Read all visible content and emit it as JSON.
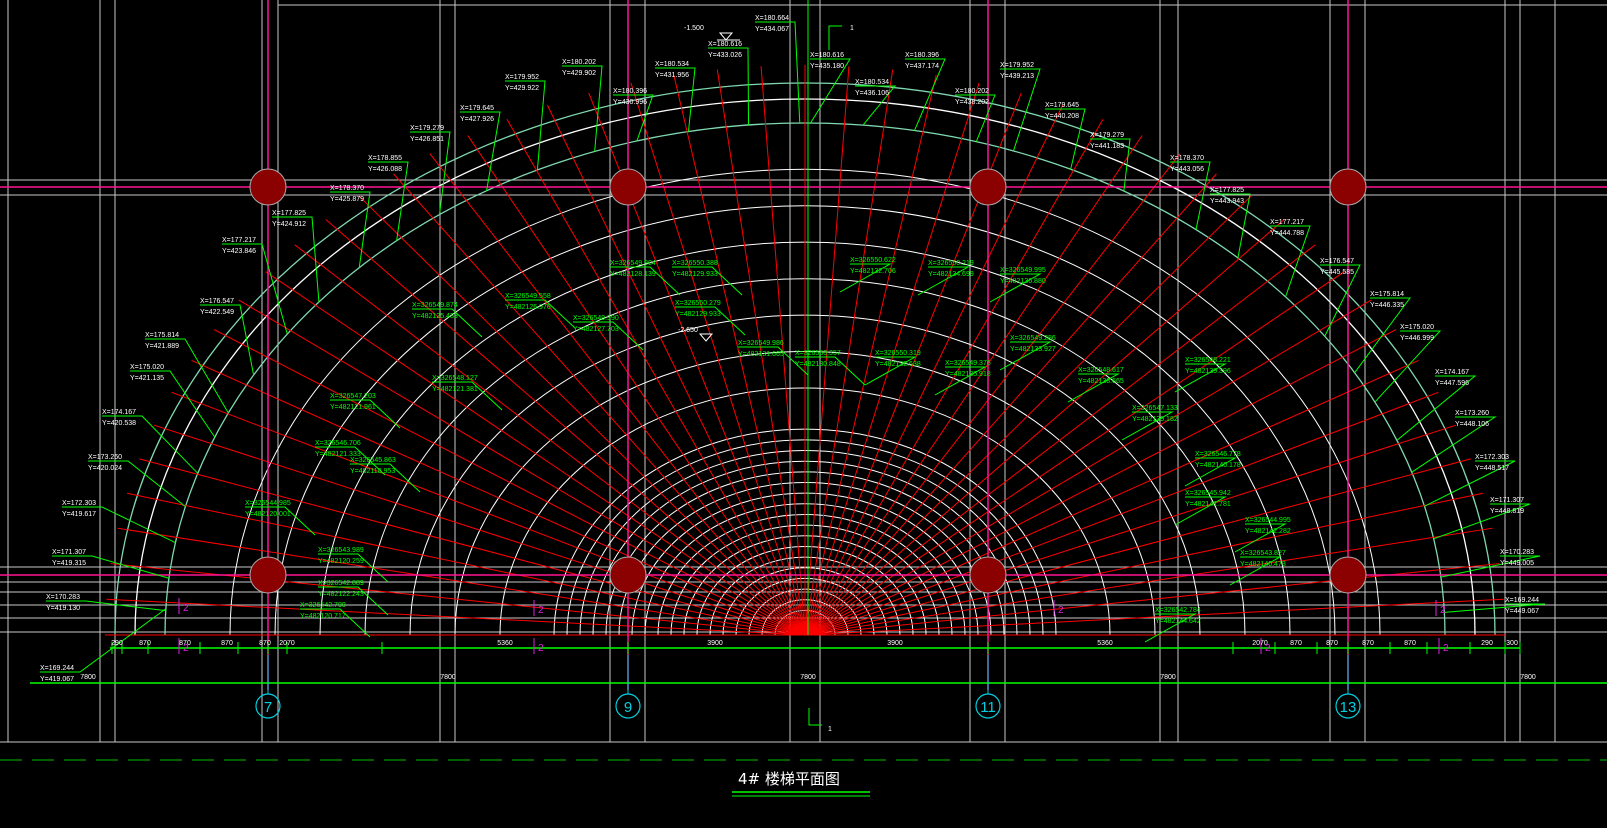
{
  "drawing": {
    "title": "4#  楼梯平面图",
    "section_mark": "1",
    "elevations": [
      "-1.500",
      "-2.650"
    ],
    "axis_labels": [
      "7",
      "9",
      "11",
      "13"
    ],
    "grid_mark": "2",
    "dimensions_row1": [
      "290",
      "870",
      "870",
      "870",
      "870",
      "2070",
      "5360",
      "3900",
      "3900",
      "5360",
      "2070",
      "870",
      "870",
      "870",
      "870",
      "290",
      "300"
    ],
    "dimensions_row2": [
      "7800",
      "7800",
      "7800",
      "7800",
      "7800"
    ],
    "outer_points": [
      {
        "x": "X=180.664",
        "y": "Y=434.067"
      },
      {
        "x": "X=180.616",
        "y": "Y=433.026"
      },
      {
        "x": "X=180.534",
        "y": "Y=431.956"
      },
      {
        "x": "X=180.396",
        "y": "Y=430.996"
      },
      {
        "x": "X=180.202",
        "y": "Y=429.902"
      },
      {
        "x": "X=179.952",
        "y": "Y=429.922"
      },
      {
        "x": "X=179.645",
        "y": "Y=427.926"
      },
      {
        "x": "X=179.279",
        "y": "Y=426.851"
      },
      {
        "x": "X=178.855",
        "y": "Y=426.088"
      },
      {
        "x": "X=178.370",
        "y": "Y=425.879"
      },
      {
        "x": "X=177.825",
        "y": "Y=424.912"
      },
      {
        "x": "X=177.217",
        "y": "Y=423.846"
      },
      {
        "x": "X=176.547",
        "y": "Y=422.549"
      },
      {
        "x": "X=175.814",
        "y": "Y=421.889"
      },
      {
        "x": "X=175.020",
        "y": "Y=421.135"
      },
      {
        "x": "X=174.167",
        "y": "Y=420.538"
      },
      {
        "x": "X=173.260",
        "y": "Y=420.024"
      },
      {
        "x": "X=172.303",
        "y": "Y=419.617"
      },
      {
        "x": "X=171.307",
        "y": "Y=419.315"
      },
      {
        "x": "X=170.283",
        "y": "Y=419.130"
      },
      {
        "x": "X=169.244",
        "y": "Y=419.067"
      },
      {
        "x": "X=180.616",
        "y": "Y=435.180"
      },
      {
        "x": "X=180.534",
        "y": "Y=436.106"
      },
      {
        "x": "X=180.396",
        "y": "Y=437.174"
      },
      {
        "x": "X=180.202",
        "y": "Y=438.202"
      },
      {
        "x": "X=179.952",
        "y": "Y=439.213"
      },
      {
        "x": "X=179.645",
        "y": "Y=440.208"
      },
      {
        "x": "X=179.279",
        "y": "Y=441.183"
      },
      {
        "x": "X=178.370",
        "y": "Y=443.056"
      },
      {
        "x": "X=177.825",
        "y": "Y=443.943"
      },
      {
        "x": "X=177.217",
        "y": "Y=444.788"
      },
      {
        "x": "X=176.547",
        "y": "Y=445.585"
      },
      {
        "x": "X=175.814",
        "y": "Y=446.335"
      },
      {
        "x": "X=175.020",
        "y": "Y=446.999"
      },
      {
        "x": "X=174.167",
        "y": "Y=447.596"
      },
      {
        "x": "X=173.260",
        "y": "Y=448.106"
      },
      {
        "x": "X=172.303",
        "y": "Y=448.517"
      },
      {
        "x": "X=171.307",
        "y": "Y=448.819"
      },
      {
        "x": "X=170.283",
        "y": "Y=449.005"
      },
      {
        "x": "X=169.244",
        "y": "Y=449.067"
      }
    ],
    "inner_points": [
      {
        "x": "X=326549.904",
        "y": "Y=482128.139"
      },
      {
        "x": "X=326550.388",
        "y": "Y=482129.933"
      },
      {
        "x": "X=326550.279",
        "y": "Y=482129.933"
      },
      {
        "x": "X=326550.622",
        "y": "Y=482132.706"
      },
      {
        "x": "X=326550.219",
        "y": "Y=482134.699"
      },
      {
        "x": "X=326549.995",
        "y": "Y=482136.880"
      },
      {
        "x": "X=326549.558",
        "y": "Y=482126.976"
      },
      {
        "x": "X=326549.874",
        "y": "Y=482125.433"
      },
      {
        "x": "X=326549.990",
        "y": "Y=482127.703"
      },
      {
        "x": "X=326549.986",
        "y": "Y=482131.665"
      },
      {
        "x": "X=326550.357",
        "y": "Y=482130.848"
      },
      {
        "x": "X=326550.319",
        "y": "Y=482132.638"
      },
      {
        "x": "X=326549.376",
        "y": "Y=482135.918"
      },
      {
        "x": "X=326549.286",
        "y": "Y=482133.927"
      },
      {
        "x": "X=326548.617",
        "y": "Y=482138.665"
      },
      {
        "x": "X=326548.221",
        "y": "Y=482139.396"
      },
      {
        "x": "X=326547.133",
        "y": "Y=482139.182"
      },
      {
        "x": "X=326546.778",
        "y": "Y=482140.178"
      },
      {
        "x": "X=326545.942",
        "y": "Y=482141.781"
      },
      {
        "x": "X=326544.995",
        "y": "Y=482142.282"
      },
      {
        "x": "X=326543.827",
        "y": "Y=482140.473"
      },
      {
        "x": "X=326542.784",
        "y": "Y=482144.642"
      },
      {
        "x": "X=326548.127",
        "y": "Y=482121.381"
      },
      {
        "x": "X=326547.203",
        "y": "Y=482121.961"
      },
      {
        "x": "X=326546.706",
        "y": "Y=482121.333"
      },
      {
        "x": "X=326545.863",
        "y": "Y=482118.953"
      },
      {
        "x": "X=326544.985",
        "y": "Y=482120.001"
      },
      {
        "x": "X=326543.989",
        "y": "Y=482120.259"
      },
      {
        "x": "X=326542.889",
        "y": "Y=482122.243"
      },
      {
        "x": "X=326542.799",
        "y": "Y=482120.717"
      }
    ]
  },
  "colors": {
    "background": "#000000",
    "grid": "#c8c8c8",
    "centerline": "#ff1493",
    "arc": "#ffffff",
    "outer_arc": "#7fd8b0",
    "radial": "#ff0000",
    "leader": "#00ff00",
    "column": "#8b0000",
    "axis_bubble": "#00d0e0"
  }
}
